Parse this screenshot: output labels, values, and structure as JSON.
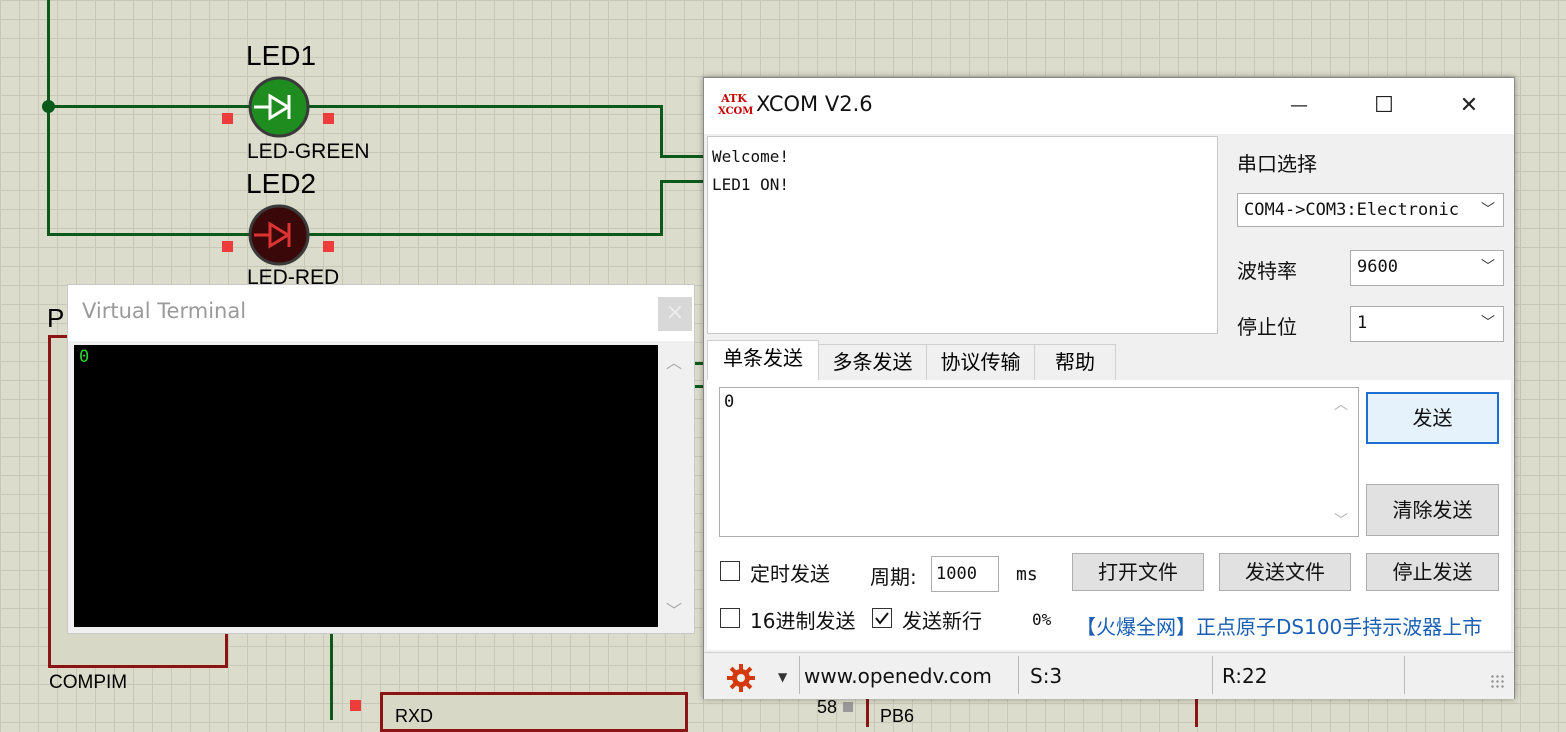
{
  "schematic": {
    "led1_label": "LED1",
    "led1_type": "LED-GREEN",
    "led2_label": "LED2",
    "led2_type": "LED-RED",
    "p_label": "P",
    "compim_label": "COMPIM",
    "rxd_label": "RXD",
    "pin58_label": "58",
    "pb6_label": "PB6",
    "led1_color": "#1e8c1e",
    "led2_color": "#3a0808"
  },
  "virtual_terminal": {
    "title": "Virtual Terminal",
    "content": "0",
    "close_glyph": "×"
  },
  "xcom": {
    "logo_top": "ATK",
    "logo_bottom": "XCOM",
    "title": "XCOM V2.6",
    "minimize_glyph": "—",
    "maximize_glyph": "☐",
    "close_glyph": "✕",
    "receive_lines": [
      "Welcome!",
      "LED1 ON!"
    ],
    "port_select_label": "串口选择",
    "port_value": "COM4->COM3:Electronic",
    "baud_label": "波特率",
    "baud_value": "9600",
    "stopbit_label": "停止位",
    "stopbit_value": "1",
    "tabs": [
      "单条发送",
      "多条发送",
      "协议传输",
      "帮助"
    ],
    "send_text": "0",
    "send_button": "发送",
    "clear_send_button": "清除发送",
    "timed_send_label": "定时发送",
    "period_label": "周期:",
    "period_value": "1000",
    "period_unit": "ms",
    "open_file_button": "打开文件",
    "send_file_button": "发送文件",
    "stop_send_button": "停止发送",
    "hex_send_label": "16进制发送",
    "newline_label": "发送新行",
    "progress": "0%",
    "ad_text": "【火爆全网】正点原子DS100手持示波器上市",
    "status": {
      "url": "www.openedv.com",
      "sent": "S:3",
      "received": "R:22"
    },
    "accent_color": "#1a5fb4",
    "gear_color": "#d4380d"
  }
}
